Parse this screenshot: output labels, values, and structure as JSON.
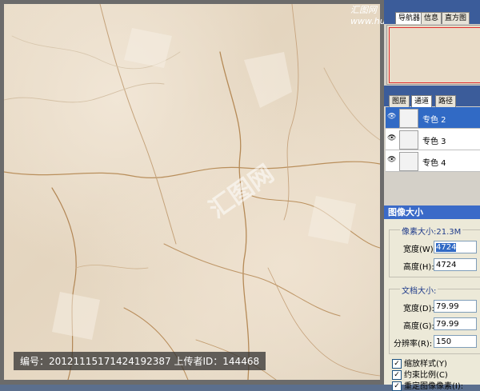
{
  "canvas": {
    "watermark_center": "汇图网",
    "caption": "编号：20121115171424192387 上传者ID：144468"
  },
  "top_logo": "汇图网 www.huitu.com",
  "navigator": {
    "tabs": [
      "导航器",
      "信息",
      "直方图"
    ]
  },
  "layers_panel": {
    "tabs": [
      "图层",
      "通道",
      "路径"
    ],
    "channels": [
      {
        "label": "专色 2",
        "selected": true
      },
      {
        "label": "专色 3",
        "selected": false
      },
      {
        "label": "专色 4",
        "selected": false
      }
    ]
  },
  "image_size_dialog": {
    "title": "图像大小",
    "pixel_group_label": "像素大小:21.3M",
    "width_label": "宽度(W):",
    "width_value": "4724",
    "height_label": "高度(H):",
    "height_value": "4724",
    "doc_group_label": "文档大小:",
    "doc_width_label": "宽度(D):",
    "doc_width_value": "79.99",
    "doc_height_label": "高度(G):",
    "doc_height_value": "79.99",
    "resolution_label": "分辨率(R):",
    "resolution_value": "150",
    "scale_styles_label": "缩放样式(Y)",
    "constrain_label": "约束比例(C)",
    "resample_label": "重定图像像素(I):"
  }
}
